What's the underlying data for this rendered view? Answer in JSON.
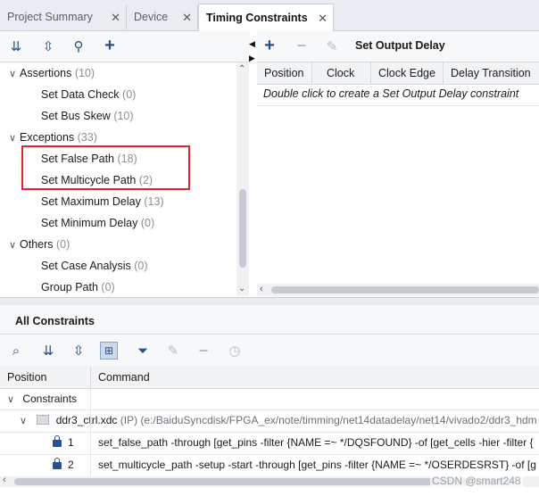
{
  "tabs": [
    {
      "label": "Project Summary"
    },
    {
      "label": "Device"
    },
    {
      "label": "Timing Constraints"
    }
  ],
  "tree": {
    "groups": [
      {
        "label": "Assertions",
        "count": "(10)",
        "items": [
          {
            "label": "Set Data Check",
            "count": "(0)"
          },
          {
            "label": "Set Bus Skew",
            "count": "(10)"
          }
        ]
      },
      {
        "label": "Exceptions",
        "count": "(33)",
        "items": [
          {
            "label": "Set False Path",
            "count": "(18)"
          },
          {
            "label": "Set Multicycle Path",
            "count": "(2)"
          },
          {
            "label": "Set Maximum Delay",
            "count": "(13)"
          },
          {
            "label": "Set Minimum Delay",
            "count": "(0)"
          }
        ]
      },
      {
        "label": "Others",
        "count": "(0)",
        "items": [
          {
            "label": "Set Case Analysis",
            "count": "(0)"
          },
          {
            "label": "Group Path",
            "count": "(0)"
          }
        ]
      }
    ]
  },
  "right_panel": {
    "title": "Set Output Delay",
    "columns": [
      "Position",
      "Clock",
      "Clock Edge",
      "Delay Transition"
    ],
    "hint": "Double click to create a Set Output Delay constraint"
  },
  "all_constraints": {
    "title": "All Constraints",
    "columns": [
      "Position",
      "Command"
    ],
    "group_label": "Constraints",
    "file_name": "ddr3_ctrl.xdc",
    "file_meta": "(IP) (e:/BaiduSyncdisk/FPGA_ex/note/timming/net14datadelay/net14/vivado2/ddr3_hdm",
    "rows": [
      {
        "position": "1",
        "command": "set_false_path -through [get_pins -filter {NAME =~ */DQSFOUND} -of [get_cells -hier -filter {"
      },
      {
        "position": "2",
        "command": "set_multicycle_path -setup -start -through [get_pins -filter {NAME =~ */OSERDESRST} -of [g"
      }
    ]
  },
  "watermark": "CSDN @smart248",
  "colors": {
    "accent": "#2b4e8c",
    "highlight_box": "#e3262e"
  }
}
